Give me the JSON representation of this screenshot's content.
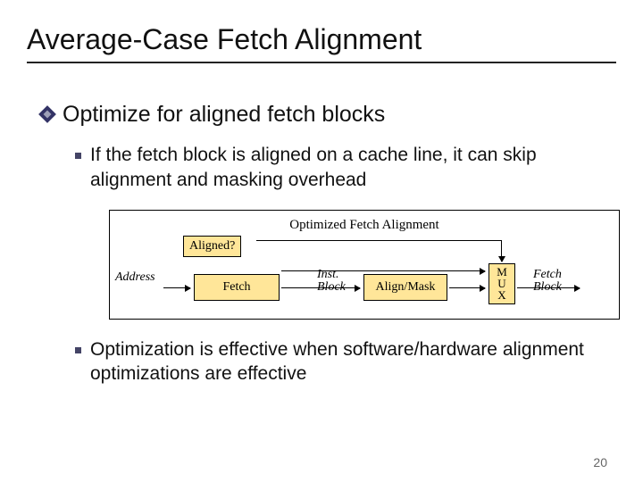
{
  "title": "Average-Case Fetch Alignment",
  "level1": "Optimize for aligned fetch blocks",
  "sub1": "If the fetch block is aligned on a cache line, it can skip alignment and masking overhead",
  "sub2": "Optimization is effective when software/hardware alignment optimizations are effective",
  "diagram": {
    "title": "Optimized Fetch Alignment",
    "aligned": "Aligned?",
    "address": "Address",
    "fetch": "Fetch",
    "inst_block": "Inst.\nBlock",
    "align_mask": "Align/Mask",
    "mux": "M\nU\nX",
    "fetch_block": "Fetch\nBlock"
  },
  "page": "20"
}
